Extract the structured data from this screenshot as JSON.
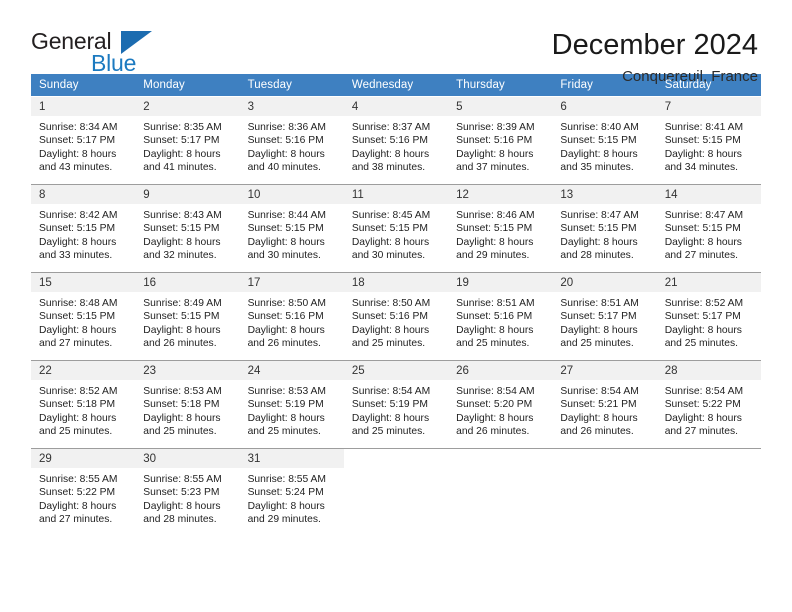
{
  "brand": {
    "name_part1": "General",
    "name_part2": "Blue",
    "triangle_color": "#1c6cb0",
    "blue_color": "#1c7ac0"
  },
  "header": {
    "title": "December 2024",
    "subtitle": "Conquereuil, France"
  },
  "calendar": {
    "header_bg": "#3e80c1",
    "header_text_color": "#ffffff",
    "daynum_bg": "#f1f1f1",
    "weekday_headers": [
      "Sunday",
      "Monday",
      "Tuesday",
      "Wednesday",
      "Thursday",
      "Friday",
      "Saturday"
    ],
    "weeks": [
      [
        {
          "day": "1",
          "sunrise": "Sunrise: 8:34 AM",
          "sunset": "Sunset: 5:17 PM",
          "daylight1": "Daylight: 8 hours",
          "daylight2": "and 43 minutes."
        },
        {
          "day": "2",
          "sunrise": "Sunrise: 8:35 AM",
          "sunset": "Sunset: 5:17 PM",
          "daylight1": "Daylight: 8 hours",
          "daylight2": "and 41 minutes."
        },
        {
          "day": "3",
          "sunrise": "Sunrise: 8:36 AM",
          "sunset": "Sunset: 5:16 PM",
          "daylight1": "Daylight: 8 hours",
          "daylight2": "and 40 minutes."
        },
        {
          "day": "4",
          "sunrise": "Sunrise: 8:37 AM",
          "sunset": "Sunset: 5:16 PM",
          "daylight1": "Daylight: 8 hours",
          "daylight2": "and 38 minutes."
        },
        {
          "day": "5",
          "sunrise": "Sunrise: 8:39 AM",
          "sunset": "Sunset: 5:16 PM",
          "daylight1": "Daylight: 8 hours",
          "daylight2": "and 37 minutes."
        },
        {
          "day": "6",
          "sunrise": "Sunrise: 8:40 AM",
          "sunset": "Sunset: 5:15 PM",
          "daylight1": "Daylight: 8 hours",
          "daylight2": "and 35 minutes."
        },
        {
          "day": "7",
          "sunrise": "Sunrise: 8:41 AM",
          "sunset": "Sunset: 5:15 PM",
          "daylight1": "Daylight: 8 hours",
          "daylight2": "and 34 minutes."
        }
      ],
      [
        {
          "day": "8",
          "sunrise": "Sunrise: 8:42 AM",
          "sunset": "Sunset: 5:15 PM",
          "daylight1": "Daylight: 8 hours",
          "daylight2": "and 33 minutes."
        },
        {
          "day": "9",
          "sunrise": "Sunrise: 8:43 AM",
          "sunset": "Sunset: 5:15 PM",
          "daylight1": "Daylight: 8 hours",
          "daylight2": "and 32 minutes."
        },
        {
          "day": "10",
          "sunrise": "Sunrise: 8:44 AM",
          "sunset": "Sunset: 5:15 PM",
          "daylight1": "Daylight: 8 hours",
          "daylight2": "and 30 minutes."
        },
        {
          "day": "11",
          "sunrise": "Sunrise: 8:45 AM",
          "sunset": "Sunset: 5:15 PM",
          "daylight1": "Daylight: 8 hours",
          "daylight2": "and 30 minutes."
        },
        {
          "day": "12",
          "sunrise": "Sunrise: 8:46 AM",
          "sunset": "Sunset: 5:15 PM",
          "daylight1": "Daylight: 8 hours",
          "daylight2": "and 29 minutes."
        },
        {
          "day": "13",
          "sunrise": "Sunrise: 8:47 AM",
          "sunset": "Sunset: 5:15 PM",
          "daylight1": "Daylight: 8 hours",
          "daylight2": "and 28 minutes."
        },
        {
          "day": "14",
          "sunrise": "Sunrise: 8:47 AM",
          "sunset": "Sunset: 5:15 PM",
          "daylight1": "Daylight: 8 hours",
          "daylight2": "and 27 minutes."
        }
      ],
      [
        {
          "day": "15",
          "sunrise": "Sunrise: 8:48 AM",
          "sunset": "Sunset: 5:15 PM",
          "daylight1": "Daylight: 8 hours",
          "daylight2": "and 27 minutes."
        },
        {
          "day": "16",
          "sunrise": "Sunrise: 8:49 AM",
          "sunset": "Sunset: 5:15 PM",
          "daylight1": "Daylight: 8 hours",
          "daylight2": "and 26 minutes."
        },
        {
          "day": "17",
          "sunrise": "Sunrise: 8:50 AM",
          "sunset": "Sunset: 5:16 PM",
          "daylight1": "Daylight: 8 hours",
          "daylight2": "and 26 minutes."
        },
        {
          "day": "18",
          "sunrise": "Sunrise: 8:50 AM",
          "sunset": "Sunset: 5:16 PM",
          "daylight1": "Daylight: 8 hours",
          "daylight2": "and 25 minutes."
        },
        {
          "day": "19",
          "sunrise": "Sunrise: 8:51 AM",
          "sunset": "Sunset: 5:16 PM",
          "daylight1": "Daylight: 8 hours",
          "daylight2": "and 25 minutes."
        },
        {
          "day": "20",
          "sunrise": "Sunrise: 8:51 AM",
          "sunset": "Sunset: 5:17 PM",
          "daylight1": "Daylight: 8 hours",
          "daylight2": "and 25 minutes."
        },
        {
          "day": "21",
          "sunrise": "Sunrise: 8:52 AM",
          "sunset": "Sunset: 5:17 PM",
          "daylight1": "Daylight: 8 hours",
          "daylight2": "and 25 minutes."
        }
      ],
      [
        {
          "day": "22",
          "sunrise": "Sunrise: 8:52 AM",
          "sunset": "Sunset: 5:18 PM",
          "daylight1": "Daylight: 8 hours",
          "daylight2": "and 25 minutes."
        },
        {
          "day": "23",
          "sunrise": "Sunrise: 8:53 AM",
          "sunset": "Sunset: 5:18 PM",
          "daylight1": "Daylight: 8 hours",
          "daylight2": "and 25 minutes."
        },
        {
          "day": "24",
          "sunrise": "Sunrise: 8:53 AM",
          "sunset": "Sunset: 5:19 PM",
          "daylight1": "Daylight: 8 hours",
          "daylight2": "and 25 minutes."
        },
        {
          "day": "25",
          "sunrise": "Sunrise: 8:54 AM",
          "sunset": "Sunset: 5:19 PM",
          "daylight1": "Daylight: 8 hours",
          "daylight2": "and 25 minutes."
        },
        {
          "day": "26",
          "sunrise": "Sunrise: 8:54 AM",
          "sunset": "Sunset: 5:20 PM",
          "daylight1": "Daylight: 8 hours",
          "daylight2": "and 26 minutes."
        },
        {
          "day": "27",
          "sunrise": "Sunrise: 8:54 AM",
          "sunset": "Sunset: 5:21 PM",
          "daylight1": "Daylight: 8 hours",
          "daylight2": "and 26 minutes."
        },
        {
          "day": "28",
          "sunrise": "Sunrise: 8:54 AM",
          "sunset": "Sunset: 5:22 PM",
          "daylight1": "Daylight: 8 hours",
          "daylight2": "and 27 minutes."
        }
      ],
      [
        {
          "day": "29",
          "sunrise": "Sunrise: 8:55 AM",
          "sunset": "Sunset: 5:22 PM",
          "daylight1": "Daylight: 8 hours",
          "daylight2": "and 27 minutes."
        },
        {
          "day": "30",
          "sunrise": "Sunrise: 8:55 AM",
          "sunset": "Sunset: 5:23 PM",
          "daylight1": "Daylight: 8 hours",
          "daylight2": "and 28 minutes."
        },
        {
          "day": "31",
          "sunrise": "Sunrise: 8:55 AM",
          "sunset": "Sunset: 5:24 PM",
          "daylight1": "Daylight: 8 hours",
          "daylight2": "and 29 minutes."
        },
        {
          "day": "",
          "sunrise": "",
          "sunset": "",
          "daylight1": "",
          "daylight2": ""
        },
        {
          "day": "",
          "sunrise": "",
          "sunset": "",
          "daylight1": "",
          "daylight2": ""
        },
        {
          "day": "",
          "sunrise": "",
          "sunset": "",
          "daylight1": "",
          "daylight2": ""
        },
        {
          "day": "",
          "sunrise": "",
          "sunset": "",
          "daylight1": "",
          "daylight2": ""
        }
      ]
    ]
  }
}
